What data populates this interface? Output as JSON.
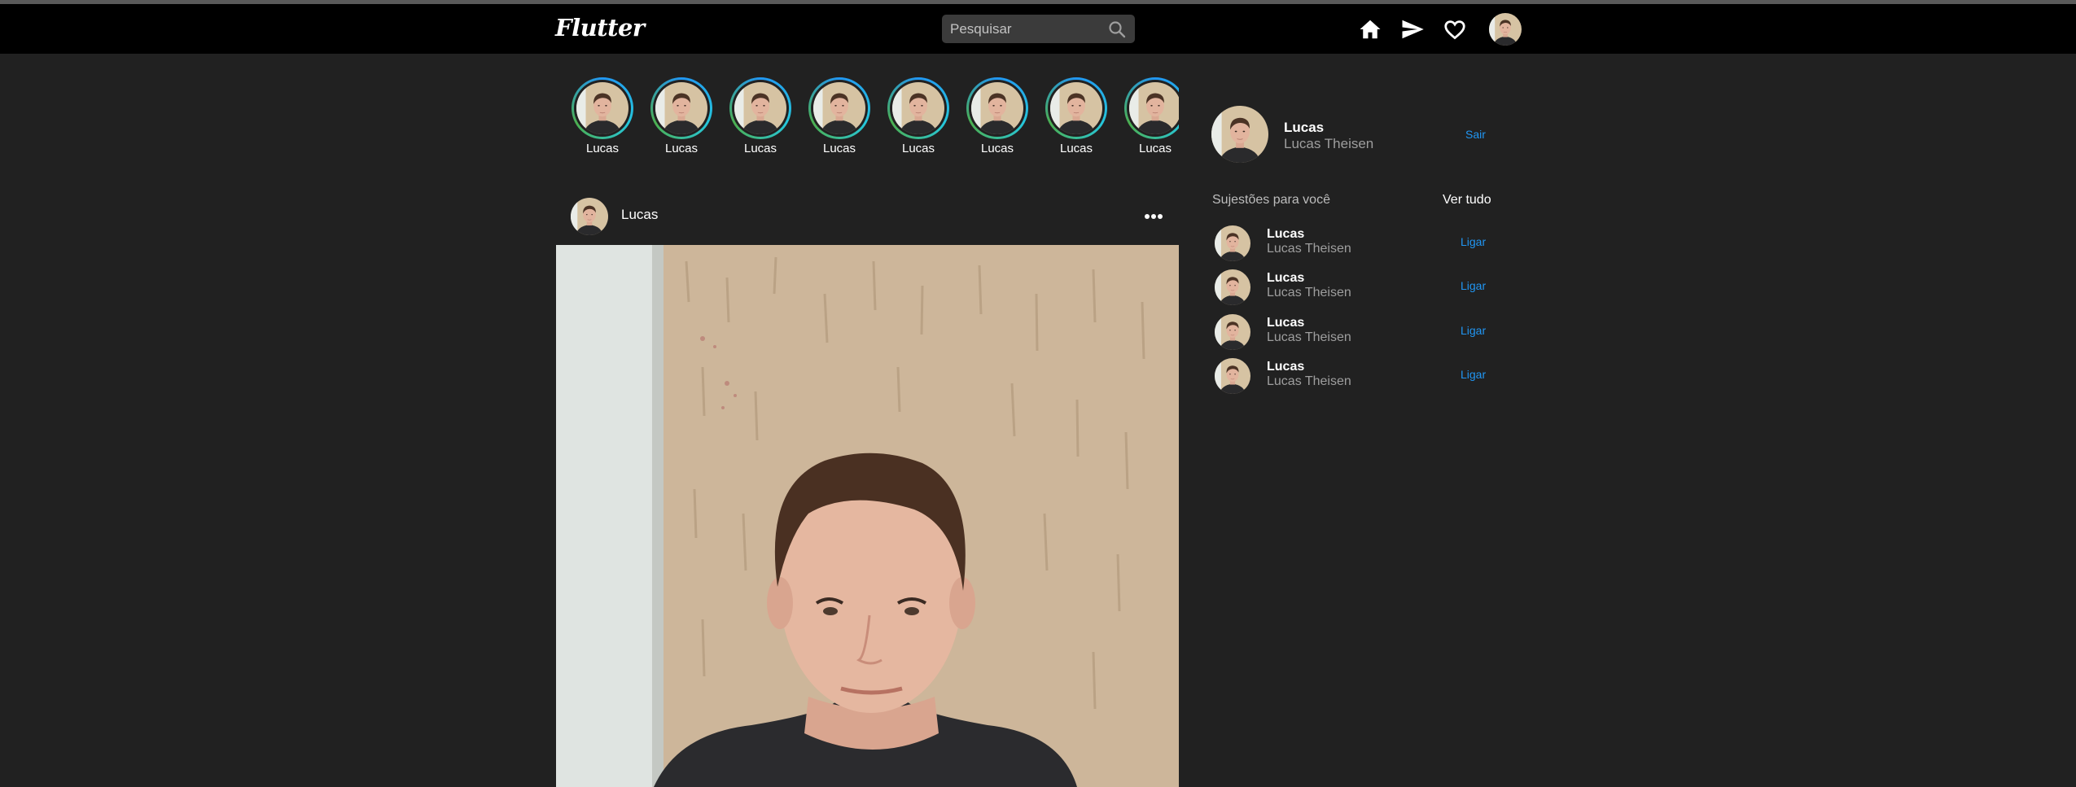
{
  "appbar": {
    "logo": "Flutter",
    "search_placeholder": "Pesquisar",
    "icons": [
      "home-icon",
      "send-icon",
      "heart-icon"
    ]
  },
  "stories": [
    {
      "name": "Lucas"
    },
    {
      "name": "Lucas"
    },
    {
      "name": "Lucas"
    },
    {
      "name": "Lucas"
    },
    {
      "name": "Lucas"
    },
    {
      "name": "Lucas"
    },
    {
      "name": "Lucas"
    },
    {
      "name": "Lucas"
    }
  ],
  "post": {
    "author": "Lucas"
  },
  "profile": {
    "name": "Lucas",
    "full_name": "Lucas Theisen",
    "logout_label": "Sair"
  },
  "suggestions": {
    "title": "Sujestões para você",
    "see_all": "Ver tudo",
    "items": [
      {
        "name": "Lucas",
        "full_name": "Lucas Theisen",
        "action": "Ligar"
      },
      {
        "name": "Lucas",
        "full_name": "Lucas Theisen",
        "action": "Ligar"
      },
      {
        "name": "Lucas",
        "full_name": "Lucas Theisen",
        "action": "Ligar"
      },
      {
        "name": "Lucas",
        "full_name": "Lucas Theisen",
        "action": "Ligar"
      }
    ]
  },
  "colors": {
    "background": "#212121",
    "appbar": "#000000",
    "accent": "#2196f3",
    "muted_text": "#9e9e9e"
  }
}
